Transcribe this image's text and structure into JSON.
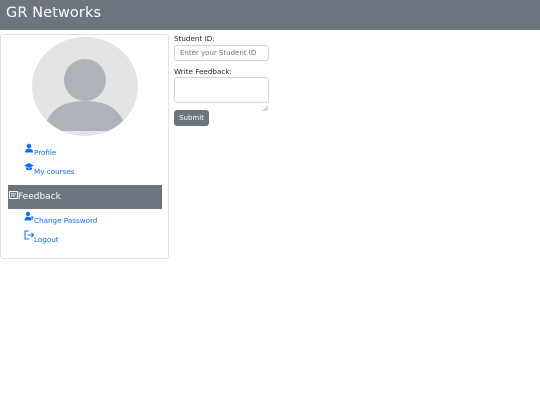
{
  "navbar": {
    "brand": "GR Networks"
  },
  "sidebar": {
    "items": [
      {
        "label": "Profile",
        "icon": "user-icon",
        "active": false
      },
      {
        "label": "My courses",
        "icon": "graduation-cap-icon",
        "active": false
      },
      {
        "label": "Feedback",
        "icon": "message-icon",
        "active": true
      },
      {
        "label": "Change Password",
        "icon": "user-key-icon",
        "active": false
      },
      {
        "label": "Logout",
        "icon": "logout-icon",
        "active": false
      }
    ]
  },
  "form": {
    "student_id_label": "Student ID:",
    "student_id_placeholder": "Enter your Student ID",
    "student_id_value": "",
    "feedback_label": "Write Feedback:",
    "feedback_value": "",
    "submit_label": "Submit"
  },
  "colors": {
    "navbar": "#6c757d",
    "link": "#0d6efd",
    "active_bg": "#6c757d",
    "avatar_bg": "#e2e4e6",
    "avatar_fg": "#adb3b8"
  }
}
